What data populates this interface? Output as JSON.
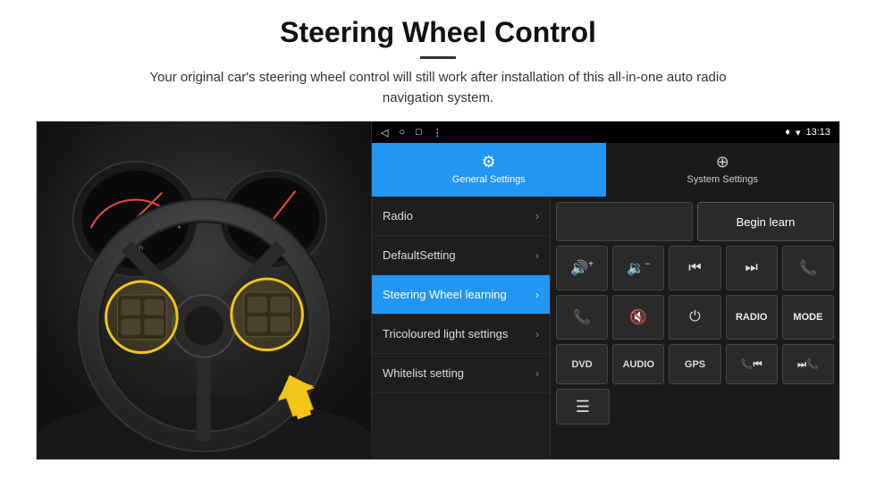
{
  "page": {
    "title": "Steering Wheel Control",
    "subtitle": "Your original car's steering wheel control will still work after installation of this all-in-one auto radio navigation system."
  },
  "status_bar": {
    "back_icon": "◁",
    "home_icon": "○",
    "recent_icon": "□",
    "menu_icon": "⋮",
    "gps_icon": "♦",
    "wifi_icon": "▾",
    "time": "13:13"
  },
  "tabs": [
    {
      "id": "general",
      "label": "General Settings",
      "icon": "⚙",
      "active": true
    },
    {
      "id": "system",
      "label": "System Settings",
      "icon": "⊕",
      "active": false
    }
  ],
  "menu_items": [
    {
      "id": "radio",
      "label": "Radio",
      "active": false
    },
    {
      "id": "default",
      "label": "DefaultSetting",
      "active": false
    },
    {
      "id": "steering",
      "label": "Steering Wheel learning",
      "active": true
    },
    {
      "id": "tricoloured",
      "label": "Tricoloured light settings",
      "active": false
    },
    {
      "id": "whitelist",
      "label": "Whitelist setting",
      "active": false
    }
  ],
  "controls": {
    "begin_learn_label": "Begin learn",
    "row1": [
      {
        "id": "vol-up",
        "icon": "🔊+",
        "label": "vol-up"
      },
      {
        "id": "vol-down",
        "icon": "🔉−",
        "label": "vol-down"
      },
      {
        "id": "prev-track",
        "icon": "⏮",
        "label": "prev-track"
      },
      {
        "id": "next-track",
        "icon": "⏭",
        "label": "next-track"
      },
      {
        "id": "phone",
        "icon": "📞",
        "label": "phone"
      }
    ],
    "row2": [
      {
        "id": "call-answer",
        "icon": "📞",
        "label": "call-answer"
      },
      {
        "id": "mute",
        "icon": "🔇",
        "label": "mute"
      },
      {
        "id": "power",
        "icon": "⏻",
        "label": "power"
      },
      {
        "id": "radio-btn",
        "text": "RADIO",
        "label": "radio-button"
      },
      {
        "id": "mode-btn",
        "text": "MODE",
        "label": "mode-button"
      }
    ],
    "row3": [
      {
        "id": "dvd-btn",
        "text": "DVD",
        "label": "dvd-button"
      },
      {
        "id": "audio-btn",
        "text": "AUDIO",
        "label": "audio-button"
      },
      {
        "id": "gps-btn",
        "text": "GPS",
        "label": "gps-button"
      },
      {
        "id": "phone2",
        "icon": "📞⏮",
        "label": "phone-prev"
      },
      {
        "id": "skip2",
        "icon": "⏭📞",
        "label": "phone-next"
      }
    ],
    "row4": [
      {
        "id": "list-icon",
        "icon": "≡",
        "label": "list-icon"
      }
    ]
  }
}
